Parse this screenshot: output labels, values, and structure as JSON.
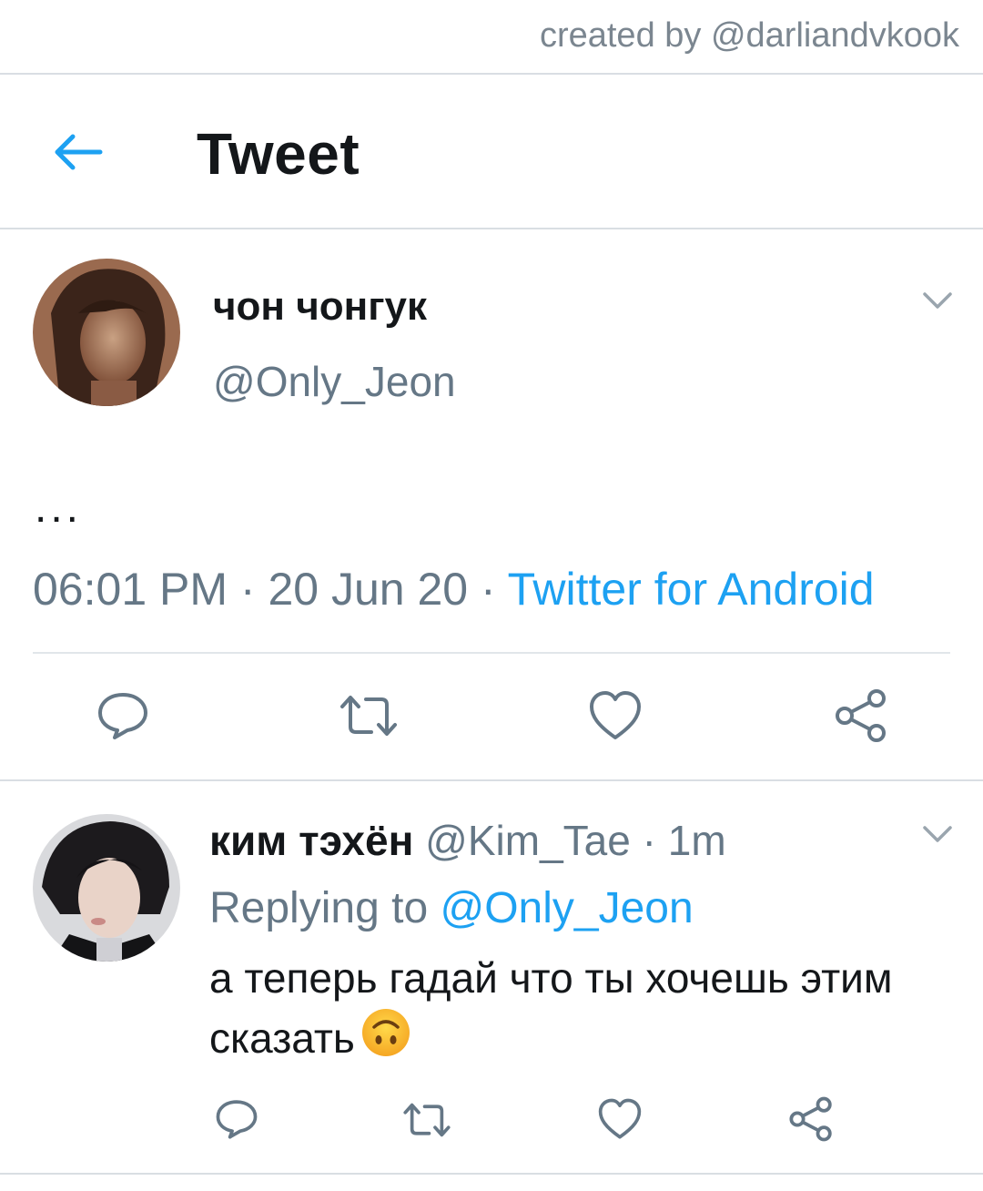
{
  "credit": "created by @darliandvkook",
  "header": {
    "title": "Tweet"
  },
  "tweet": {
    "author_name": "чон чонгук",
    "author_handle": "@Only_Jeon",
    "text": "...",
    "time": "06:01 PM",
    "date": "20 Jun 20",
    "source": "Twitter for Android",
    "separator": " · "
  },
  "reply": {
    "author_name": "ким тэхён",
    "author_handle": "@Kim_Tae",
    "time": "1m",
    "replying_prefix": "Replying to ",
    "replying_handle": "@Only_Jeon",
    "text": "а теперь гадай что ты хочешь этим сказать"
  },
  "icons": {
    "back": "arrow-left-icon",
    "chevron": "chevron-down-icon",
    "reply": "comment-icon",
    "retweet": "retweet-icon",
    "like": "heart-icon",
    "share": "share-icon",
    "emoji": "upside-down-face-emoji"
  },
  "colors": {
    "accent": "#1da1f2",
    "secondary_text": "#657786",
    "primary_text": "#14171a"
  }
}
